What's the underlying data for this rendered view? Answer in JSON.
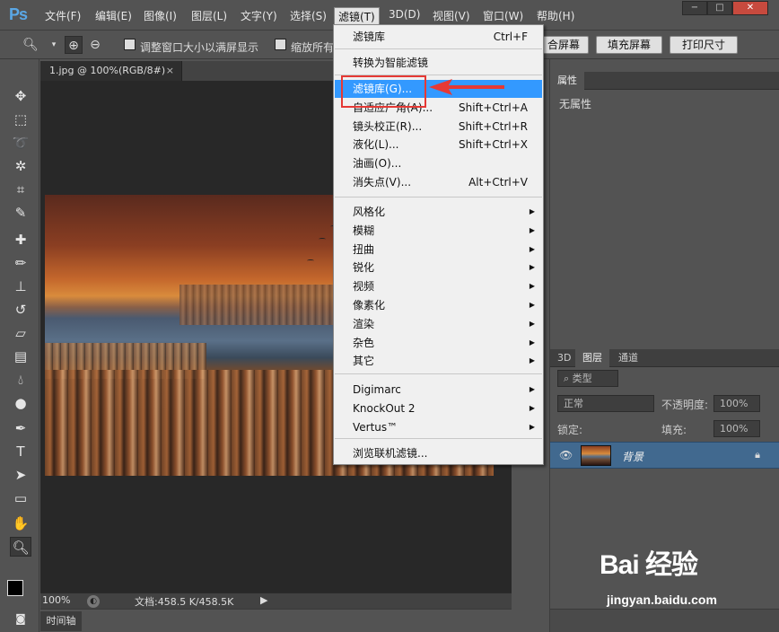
{
  "app": {
    "logo": "Ps"
  },
  "menubar": {
    "items": [
      "文件(F)",
      "编辑(E)",
      "图像(I)",
      "图层(L)",
      "文字(Y)",
      "选择(S)",
      "滤镜(T)",
      "3D(D)",
      "视图(V)",
      "窗口(W)",
      "帮助(H)"
    ],
    "active": "滤镜(T)",
    "window_buttons": [
      "−",
      "□",
      "✕"
    ]
  },
  "optionsbar": {
    "fit_window_label": "调整窗口大小以满屏显示",
    "zoom_all_label": "缩放所有",
    "fit_screen_button": "合屏幕",
    "fill_screen_button": "填充屏幕",
    "print_size_button": "打印尺寸"
  },
  "document": {
    "tab_title": "1.jpg @ 100%(RGB/8#)",
    "tab_close": "×",
    "zoom": "100%",
    "doc_info": "文档:458.5 K/458.5K",
    "timeline_label": "时间轴"
  },
  "filter_menu": {
    "items": [
      {
        "label": "滤镜库",
        "shortcut": "Ctrl+F"
      },
      {
        "label": "转换为智能滤镜"
      },
      {
        "label": "滤镜库(G)...",
        "highlighted": true
      },
      {
        "label": "自适应广角(A)...",
        "shortcut": "Shift+Ctrl+A"
      },
      {
        "label": "镜头校正(R)...",
        "shortcut": "Shift+Ctrl+R"
      },
      {
        "label": "液化(L)...",
        "shortcut": "Shift+Ctrl+X"
      },
      {
        "label": "油画(O)..."
      },
      {
        "label": "消失点(V)...",
        "shortcut": "Alt+Ctrl+V"
      },
      {
        "label": "风格化",
        "submenu": true
      },
      {
        "label": "模糊",
        "submenu": true
      },
      {
        "label": "扭曲",
        "submenu": true
      },
      {
        "label": "锐化",
        "submenu": true
      },
      {
        "label": "视频",
        "submenu": true
      },
      {
        "label": "像素化",
        "submenu": true
      },
      {
        "label": "渲染",
        "submenu": true
      },
      {
        "label": "杂色",
        "submenu": true
      },
      {
        "label": "其它",
        "submenu": true
      },
      {
        "label": "Digimarc",
        "submenu": true
      },
      {
        "label": "KnockOut 2",
        "submenu": true
      },
      {
        "label": "Vertus™",
        "submenu": true
      },
      {
        "label": "浏览联机滤镜..."
      }
    ]
  },
  "properties_panel": {
    "tab": "属性",
    "empty_text": "无属性"
  },
  "layers_panel": {
    "tabs": [
      "3D",
      "图层",
      "通道"
    ],
    "active_tab": "图层",
    "filter_kind": "类型",
    "blend_mode": "正常",
    "opacity_label": "不透明度:",
    "opacity_value": "100%",
    "lock_label": "锁定:",
    "fill_label": "填充:",
    "fill_value": "100%",
    "layer_name": "背景"
  },
  "watermark": {
    "brand": "Bai 经验",
    "url": "jingyan.baidu.com"
  },
  "colors": {
    "ui_dark": "#535353",
    "highlight_blue": "#3399ff",
    "annotation_red": "#e53935",
    "layer_selected": "#41698f"
  }
}
